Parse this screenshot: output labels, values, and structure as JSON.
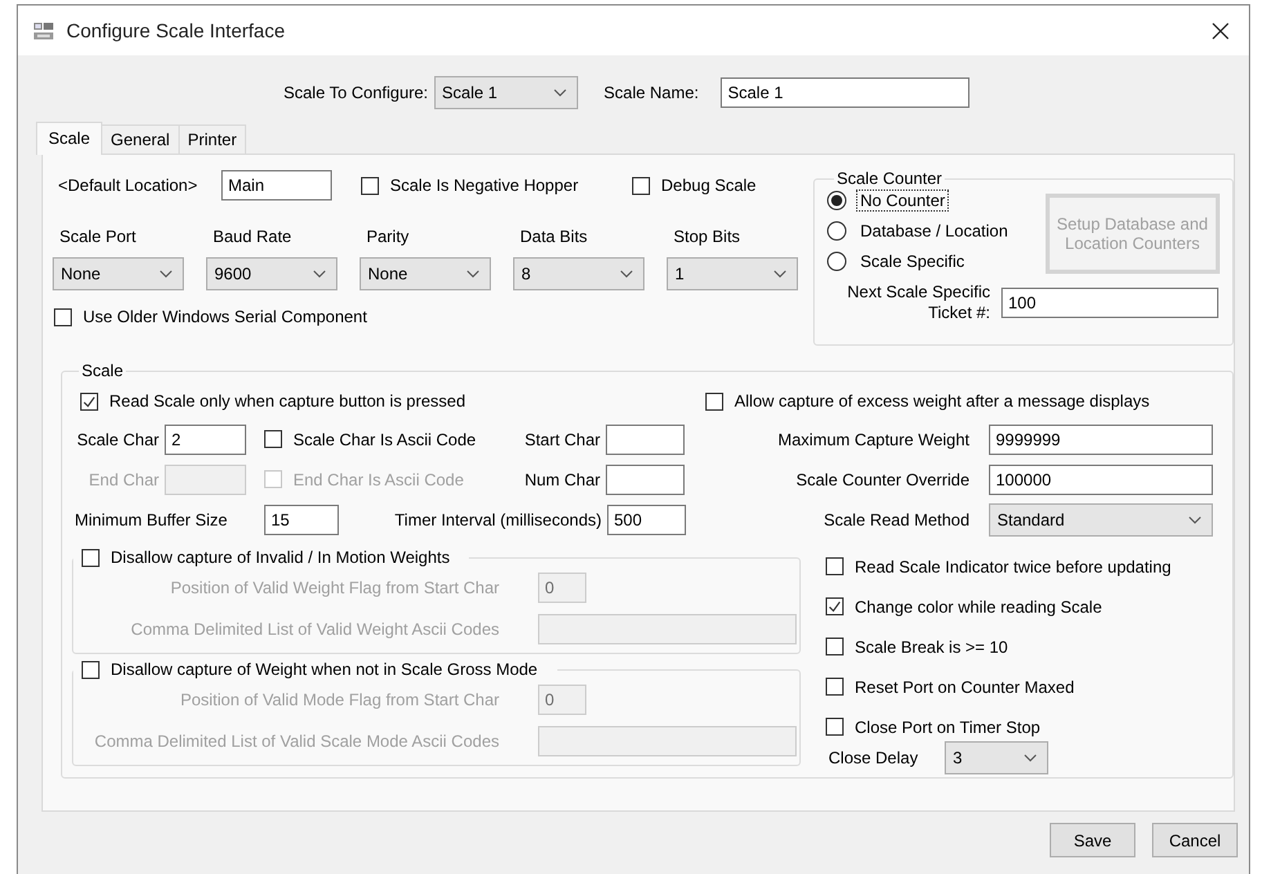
{
  "window": {
    "title": "Configure Scale Interface"
  },
  "scale_to_configure": {
    "label": "Scale To Configure:",
    "value": "Scale 1"
  },
  "scale_name": {
    "label": "Scale Name:",
    "value": "Scale 1"
  },
  "tabs": [
    {
      "label": "Scale",
      "selected": true
    },
    {
      "label": "General",
      "selected": false
    },
    {
      "label": "Printer",
      "selected": false
    }
  ],
  "default_location": {
    "label": "<Default Location>",
    "value": "Main"
  },
  "options_top": [
    {
      "label": "Scale Is Negative Hopper",
      "checked": false
    },
    {
      "label": "Debug Scale",
      "checked": false
    }
  ],
  "serial_settings": [
    {
      "label": "Scale Port",
      "value": "None"
    },
    {
      "label": "Baud Rate",
      "value": "9600"
    },
    {
      "label": "Parity",
      "value": "None"
    },
    {
      "label": "Data Bits",
      "value": "8"
    },
    {
      "label": "Stop Bits",
      "value": "1"
    }
  ],
  "use_older_serial": {
    "label": "Use Older Windows Serial Component",
    "checked": false
  },
  "scale_counter": {
    "title": "Scale Counter",
    "options": [
      {
        "label": "No Counter",
        "selected": true,
        "focused": true
      },
      {
        "label": "Database / Location",
        "selected": false,
        "focused": false
      },
      {
        "label": "Scale Specific",
        "selected": false,
        "focused": false
      }
    ],
    "setup_button": {
      "label": "Setup Database and Location Counters",
      "disabled": true
    },
    "next_ticket": {
      "label": "Next Scale Specific Ticket #:",
      "value": "100"
    }
  },
  "scale": {
    "title": "Scale",
    "read_on_capture": {
      "label": "Read Scale only when capture button is pressed",
      "checked": true
    },
    "allow_excess": {
      "label": "Allow capture of excess weight after a message displays",
      "checked": false
    },
    "scale_char": {
      "label": "Scale Char",
      "value": "2"
    },
    "scale_char_ascii": {
      "label": "Scale Char Is Ascii Code",
      "checked": false
    },
    "start_char": {
      "label": "Start Char"
    },
    "end_char": {
      "label": "End Char",
      "disabled": true
    },
    "end_char_ascii": {
      "label": "End Char Is Ascii Code",
      "checked": false,
      "disabled": true
    },
    "num_char": {
      "label": "Num Char"
    },
    "min_buffer": {
      "label": "Minimum Buffer Size",
      "value": "15"
    },
    "timer_interval": {
      "label": "Timer Interval (milliseconds)",
      "value": "500"
    },
    "limits": [
      {
        "kind": "text",
        "label": "Maximum Capture Weight",
        "value": "9999999"
      },
      {
        "kind": "text",
        "label": "Scale Counter Override",
        "value": "100000"
      },
      {
        "kind": "combo",
        "label": "Scale Read Method",
        "value": "Standard"
      }
    ],
    "validation_groups": [
      {
        "label": "Disallow capture of Invalid / In Motion Weights",
        "checked": false,
        "fields": [
          {
            "label": "Position of Valid Weight Flag from Start Char",
            "value": "0",
            "disabled": true
          },
          {
            "label": "Comma Delimited List of Valid Weight Ascii Codes",
            "disabled": true
          }
        ]
      },
      {
        "label": "Disallow capture of Weight when not in Scale Gross Mode",
        "checked": false,
        "fields": [
          {
            "label": "Position of Valid Mode Flag from Start Char",
            "value": "0",
            "disabled": true
          },
          {
            "label": "Comma Delimited List of Valid Scale Mode Ascii Codes",
            "disabled": true
          }
        ]
      }
    ],
    "behaviors": [
      {
        "label": "Read Scale Indicator twice before updating",
        "checked": false
      },
      {
        "label": "Change color while reading Scale",
        "checked": true
      },
      {
        "label": "Scale Break is >= 10",
        "checked": false
      },
      {
        "label": "Reset Port on Counter Maxed",
        "checked": false
      },
      {
        "label": "Close Port on Timer Stop",
        "checked": false
      }
    ],
    "close_delay": {
      "label": "Close Delay",
      "value": "3"
    }
  },
  "buttons": [
    {
      "label": "Save"
    },
    {
      "label": "Cancel"
    }
  ]
}
